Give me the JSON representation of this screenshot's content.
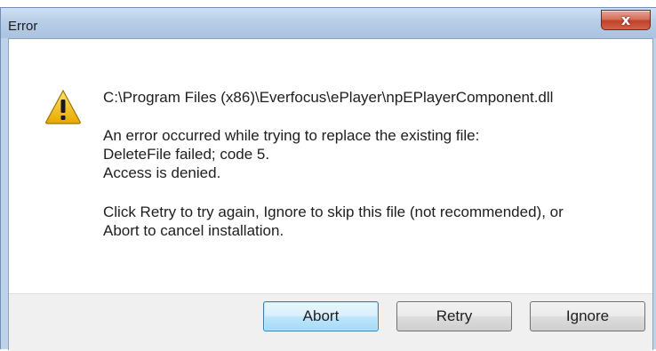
{
  "window": {
    "title": "Error",
    "close_label": "x"
  },
  "message": {
    "path": "C:\\Program Files (x86)\\Everfocus\\ePlayer\\npEPlayerComponent.dll",
    "line1": "An error occurred while trying to replace the existing file:",
    "line2": "DeleteFile failed; code 5.",
    "line3": "Access is denied.",
    "line4": "Click Retry to try again, Ignore to skip this file (not recommended), or",
    "line5": "Abort to cancel installation."
  },
  "buttons": {
    "abort": "Abort",
    "retry": "Retry",
    "ignore": "Ignore"
  },
  "icons": {
    "warning": "warning-icon",
    "close": "close-icon"
  },
  "colors": {
    "warning_fill": "#f5c400",
    "close_button": "#c3412a",
    "titlebar": "#bfd3e8"
  }
}
